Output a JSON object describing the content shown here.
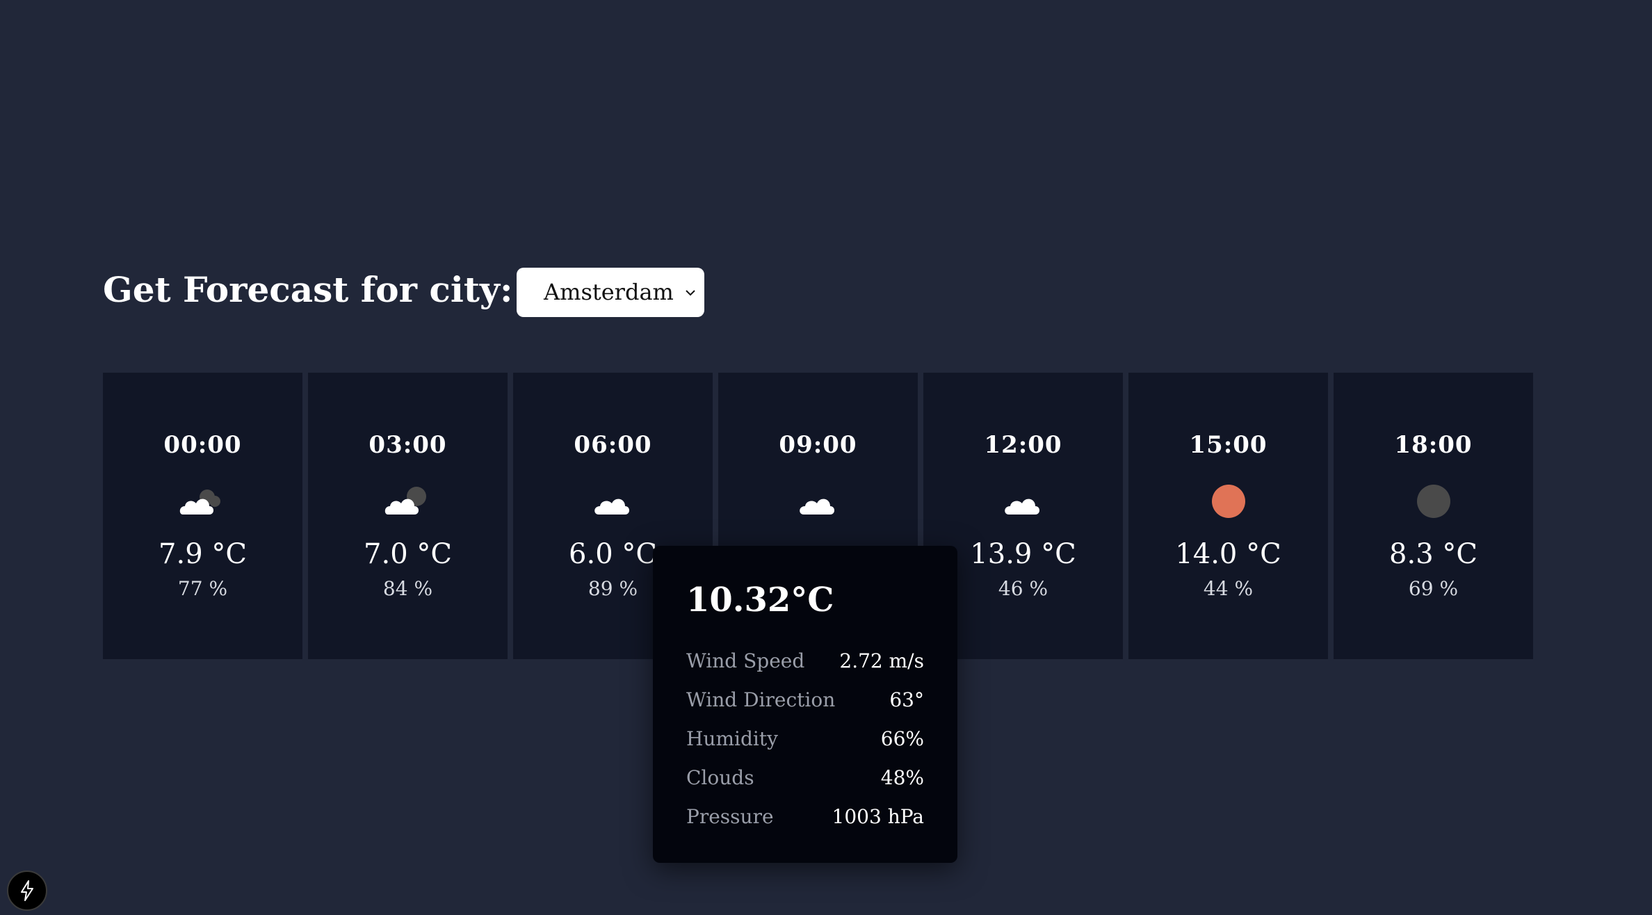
{
  "header": {
    "title": "Get Forecast for city:"
  },
  "city_select": {
    "selected": "Amsterdam"
  },
  "forecast": [
    {
      "time": "00:00",
      "icon": "cloud-moon-icon",
      "temp": "7.9 °C",
      "humidity": "77 %"
    },
    {
      "time": "03:00",
      "icon": "cloud-moon-icon",
      "temp": "7.0 °C",
      "humidity": "84 %"
    },
    {
      "time": "06:00",
      "icon": "cloud-icon",
      "temp": "6.0 °C",
      "humidity": "89 %"
    },
    {
      "time": "09:00",
      "icon": "cloud-icon",
      "temp": "",
      "humidity": ""
    },
    {
      "time": "12:00",
      "icon": "cloud-icon",
      "temp": "13.9 °C",
      "humidity": "46 %"
    },
    {
      "time": "15:00",
      "icon": "sun-icon",
      "temp": "14.0 °C",
      "humidity": "44 %"
    },
    {
      "time": "18:00",
      "icon": "moon-icon",
      "temp": "8.3 °C",
      "humidity": "69 %"
    }
  ],
  "tooltip": {
    "temp": "10.32°C",
    "rows": [
      {
        "label": "Wind Speed",
        "value": "2.72 m/s"
      },
      {
        "label": "Wind Direction",
        "value": "63°"
      },
      {
        "label": "Humidity",
        "value": "66%"
      },
      {
        "label": "Clouds",
        "value": "48%"
      },
      {
        "label": "Pressure",
        "value": "1003 hPa"
      }
    ]
  },
  "colors": {
    "background": "#212739",
    "card": "#111626",
    "tooltip": "#03050d",
    "sun": "#e07356",
    "moon": "#4a4a4a"
  }
}
